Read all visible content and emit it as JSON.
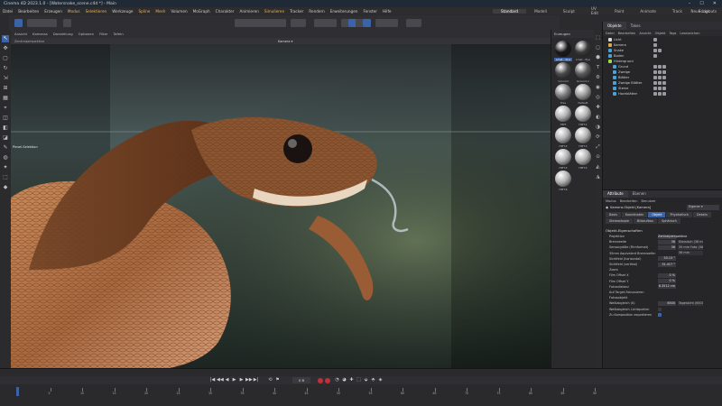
{
  "app": {
    "title": "Cinema 4D 2023.1.0 - [Watersnake_scene.c4d *] - Main",
    "window_buttons": [
      "–",
      "☐",
      "✕"
    ]
  },
  "menu": [
    "Datei",
    "Bearbeiten",
    "Erzeugen",
    "Modus",
    "Selektieren",
    "Werkzeuge",
    "Spline",
    "Mesh",
    "Volumen",
    "MoGraph",
    "Charakter",
    "Animieren",
    "Simulieren",
    "Tracker",
    "Rendern",
    "Erweiterungen",
    "Fenster",
    "Hilfe"
  ],
  "menu_highlight": [
    "Modus",
    "Selektieren",
    "Spline",
    "Mesh",
    "Simulieren"
  ],
  "layouts": [
    "Standard",
    "Modell",
    "Sculpt",
    "UV Edit",
    "Paint",
    "Animate",
    "Track",
    "Script",
    "Nodes"
  ],
  "active_layout": "Standard",
  "new_layout": "Neue Layouts",
  "viewport": {
    "menu": [
      "Ansicht",
      "Kameras",
      "Darstellung",
      "Optionen",
      "Filter",
      "Tafeln"
    ],
    "view_name": "Zentralperspektive",
    "camera": "Kamera",
    "pin_label": "Pinsel-Selektion",
    "status_left": "Transformation anzeigen: Projekt",
    "status_right": "Rasterweite : 0.1 cm"
  },
  "materials": {
    "header": "Erzeugen",
    "items": [
      {
        "label": "Lmat - Sna",
        "selected": true,
        "color": "#1a1a1a"
      },
      {
        "label": "Lmat - Eye",
        "selected": false,
        "color": "#3a3a3a"
      },
      {
        "label": "Ground",
        "selected": false,
        "color": "#4a4a4a"
      },
      {
        "label": "Ground.1",
        "selected": false,
        "color": "#5a5a5a"
      },
      {
        "label": "Tree",
        "selected": false,
        "color": "#7d7d7d"
      },
      {
        "label": "Default",
        "selected": false,
        "color": "#9a9a9a"
      },
      {
        "label": "HMT",
        "selected": false,
        "color": "#b0b0b0"
      },
      {
        "label": "HMT.1",
        "selected": false,
        "color": "#b0b0b0"
      },
      {
        "label": "HMT.2",
        "selected": false,
        "color": "#b0b0b0"
      },
      {
        "label": "HMT.3",
        "selected": false,
        "color": "#b0b0b0"
      },
      {
        "label": "HMT.4",
        "selected": false,
        "color": "#b0b0b0"
      },
      {
        "label": "HMT.5",
        "selected": false,
        "color": "#b0b0b0"
      },
      {
        "label": "HMT.6",
        "selected": false,
        "color": "#b0b0b0"
      }
    ]
  },
  "object_manager": {
    "tabs": [
      "Objekte",
      "Takes"
    ],
    "active_tab": "Objekte",
    "menu": [
      "Datei",
      "Bearbeiten",
      "Ansicht",
      "Objekt",
      "Tags",
      "Lesezeichen"
    ],
    "objects": [
      {
        "name": "Licht",
        "color": "#d9d9d9",
        "indent": 0,
        "tags": 1
      },
      {
        "name": "Kamera",
        "color": "#d9a84a",
        "indent": 0,
        "tags": 1
      },
      {
        "name": "Snake",
        "color": "#4aa0d9",
        "indent": 0,
        "tags": 2
      },
      {
        "name": "Boden",
        "color": "#4aa0d9",
        "indent": 0,
        "tags": 1
      },
      {
        "name": "Hintergrund",
        "color": "#9fd94a",
        "indent": 0,
        "tags": 0
      },
      {
        "name": "Grund",
        "color": "#4aa0d9",
        "indent": 1,
        "tags": 3
      },
      {
        "name": "Zweige",
        "color": "#4aa0d9",
        "indent": 1,
        "tags": 3
      },
      {
        "name": "Blätter",
        "color": "#4aa0d9",
        "indent": 1,
        "tags": 3
      },
      {
        "name": "Zweige Blätter",
        "color": "#4aa0d9",
        "indent": 1,
        "tags": 3
      },
      {
        "name": "Steine",
        "color": "#4aa0d9",
        "indent": 1,
        "tags": 3
      },
      {
        "name": "Hochblätter",
        "color": "#4aa0d9",
        "indent": 1,
        "tags": 3
      }
    ]
  },
  "attribute_manager": {
    "tabs": [
      "Attribute",
      "Ebenen"
    ],
    "active_tab": "Attribute",
    "menu": [
      "Modus",
      "Bearbeiten",
      "Benutzer"
    ],
    "object_title": "Kamera-Objekt [Kamera]",
    "preset": "Eigener",
    "property_tabs": [
      "Basis",
      "Koordinaten",
      "Objekt",
      "Physikalisch",
      "Details",
      "Stereoskopie",
      "Bildaufbau",
      "Sphärisch"
    ],
    "active_property_tab": "Objekt",
    "section": "Objekt-Eigenschaften",
    "fields": [
      {
        "label": "Projektion",
        "value": "Zentralperspektive",
        "ext": ""
      },
      {
        "label": "Brennweite",
        "value": "36",
        "ext": "Klassisch (36 mm)"
      },
      {
        "label": "Sensorgröße (Filmformat)",
        "value": "36",
        "ext": "35 mm Foto (36.0 mm)"
      },
      {
        "label": "35mm Äquivalent Brennweite:",
        "value": "",
        "ext": "36 mm"
      },
      {
        "label": "Sichtfeld (horizontal)",
        "value": "53.13 °",
        "ext": ""
      },
      {
        "label": "Sichtfeld (vertikal)",
        "value": "31.417 °",
        "ext": ""
      },
      {
        "label": "Zoom",
        "value": "",
        "ext": ""
      },
      {
        "label": "Film Offset X",
        "value": "0 %",
        "ext": ""
      },
      {
        "label": "Film Offset Y",
        "value": "0 %",
        "ext": ""
      },
      {
        "label": "Fokusdistanz",
        "value": "8.3512 cm",
        "ext": ""
      },
      {
        "label": "Auf Target-Fokussieren",
        "value": "",
        "ext": ""
      },
      {
        "label": "Fokusobjekt",
        "value": "",
        "ext": ""
      },
      {
        "label": "Weißabgleich (K)",
        "value": "6500",
        "ext": "Tageslicht (6500 K)"
      },
      {
        "label": "Weißabgleich Lichtquellen",
        "value": "",
        "ext": "",
        "check": false
      },
      {
        "label": "Zu Komposition exportieren",
        "value": "",
        "ext": "",
        "check": true
      }
    ]
  },
  "timeline": {
    "current_frame": "0 B",
    "ticks": [
      "0",
      "5",
      "10",
      "15",
      "20",
      "25",
      "30",
      "35",
      "40",
      "45",
      "50",
      "55",
      "60",
      "65",
      "70",
      "75",
      "80",
      "85",
      "90"
    ]
  },
  "colors": {
    "accent": "#3a63a8",
    "record": "#c0303a",
    "menu_highlight": "#f0b34a"
  }
}
